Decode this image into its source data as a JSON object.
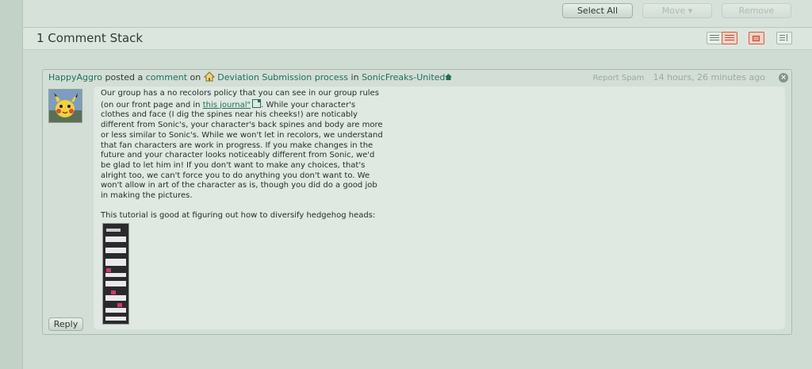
{
  "toolbar": {
    "select_all_label": "Select All",
    "move_label": "Move ▾",
    "remove_label": "Remove"
  },
  "stack": {
    "title": "1 Comment Stack"
  },
  "comment": {
    "author": "HappyAggro",
    "posted_text": "posted a",
    "comment_link": "comment",
    "on_text": "on",
    "deviation_title": "Deviation Submission process",
    "in_text": "in",
    "group_name": "SonicFreaks-United",
    "report_spam_label": "Report Spam",
    "timestamp": "14 hours, 26 minutes ago",
    "close_symbol": "×",
    "body_before_link": "Our group has a no recolors policy that you can see in our group rules (on our front page and in ",
    "journal_link": "this journal\"",
    "body_after_link": ". While your character's clothes and face (I dig the spines near his cheeks!) are noticably different from Sonic's, your character's back spines and body are more or less similar to Sonic's. While we won't let in recolors, we understand that fan characters are work in progress. If you make changes in the future and your character looks noticeably different from Sonic, we'd be glad to let him in! If you don't want to make any choices, that's alright too, we can't force you to do anything you don't want to. We won't allow in art of the character as is, though you did do a good job in making the pictures.",
    "body_paragraph2": "This tutorial is good at figuring out how to diversify hedgehog heads:",
    "reply_label": "Reply"
  },
  "colors": {
    "background": "#cfdcd3",
    "link": "#1f6f5c",
    "accent_active": "#d65a3c"
  },
  "icons": {
    "home": "home-icon",
    "group": "group-home-icon",
    "external_link": "external-link-icon",
    "close": "close-icon",
    "view_list": "list-view-icon",
    "view_thumb": "thumb-view-icon",
    "view_comment": "comment-view-icon",
    "sort": "sort-icon"
  }
}
